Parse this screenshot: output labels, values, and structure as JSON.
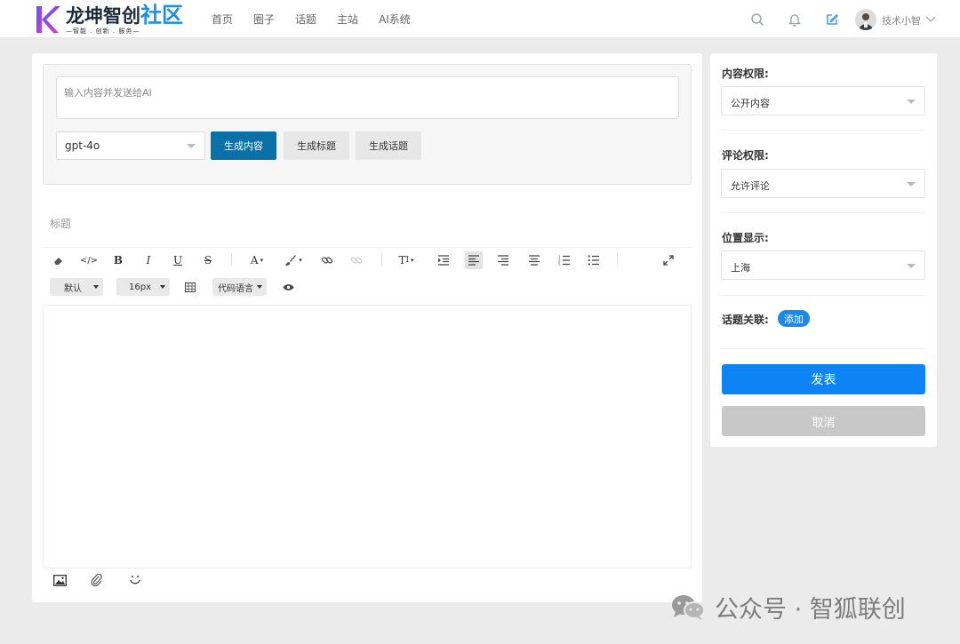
{
  "header": {
    "logo_main": "龙坤智创",
    "logo_accent": "社区",
    "logo_sub": "—智能 . 创新 . 服务—",
    "nav": [
      "首页",
      "圈子",
      "话题",
      "主站",
      "AI系统"
    ],
    "username": "技术小智"
  },
  "ai": {
    "prompt_placeholder": "输入内容并发送给AI",
    "model": "gpt-4o",
    "generate_content": "生成内容",
    "generate_title": "生成标题",
    "generate_topic": "生成话题"
  },
  "editor": {
    "title_placeholder": "标题",
    "font_family": "默认",
    "font_size": "16px",
    "code_language": "代码语言"
  },
  "sidebar": {
    "content_permission_label": "内容权限:",
    "content_permission_value": "公开内容",
    "comment_permission_label": "评论权限:",
    "comment_permission_value": "允许评论",
    "location_label": "位置显示:",
    "location_value": "上海",
    "topic_label": "话题关联:",
    "topic_add": "添加",
    "publish": "发表",
    "cancel": "取消"
  },
  "watermark": "公众号 · 智狐联创",
  "colors": {
    "primary_button": "#0a71a8",
    "publish_button": "#0d84f5",
    "cancel_button": "#c8c8c8",
    "tag": "#1a89ea",
    "logo_accent": "#1d8ee6"
  }
}
